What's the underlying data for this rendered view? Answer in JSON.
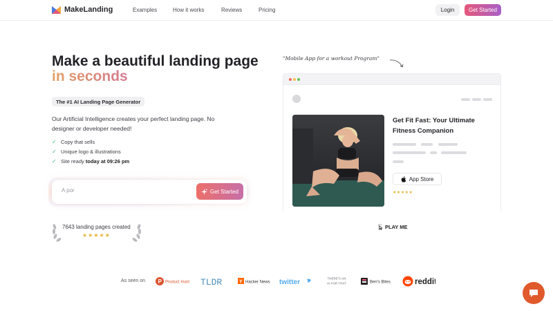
{
  "nav": {
    "brand": "MakeLanding",
    "links": [
      "Examples",
      "How it works",
      "Reviews",
      "Pricing"
    ],
    "login": "Login",
    "get_started": "Get Started"
  },
  "hero": {
    "title_line1": "Make a beautiful landing page",
    "title_line2": "in seconds",
    "badge": "The #1 AI Landing Page Generator",
    "description": "Our Artificial Intelligence creates your perfect landing page. No designer or developer needed!",
    "features": [
      {
        "text": "Copy that sells"
      },
      {
        "text": "Unique logo & illustrations"
      },
      {
        "prefix": "Site ready ",
        "bold": "today at 09:26 pm"
      }
    ],
    "prompt_value": "A por",
    "prompt_button": "Get Started",
    "pages_created": "7643 landing pages created",
    "rating_stars": 5
  },
  "preview": {
    "annotation": "\"Mobile App for a workout Program\"",
    "title": "Get Fit Fast: Your Ultimate Fitness Companion",
    "app_store": "App Store",
    "stars": 5,
    "play": "PLAY ME"
  },
  "press": {
    "label": "As seen on",
    "logos": [
      "Product Hunt",
      "TLDR",
      "Hacker News",
      "twitter",
      "THERE'S AN AI FOR THAT",
      "Ben's Bites",
      "reddit"
    ]
  },
  "colors": {
    "accent_start": "#e5587a",
    "accent_end": "#a85fc7",
    "gradient_text_start": "#e2a064",
    "gradient_text_end": "#d57a90",
    "check": "#3fb77c",
    "star": "#e6b33a",
    "chat": "#e05a2c"
  }
}
